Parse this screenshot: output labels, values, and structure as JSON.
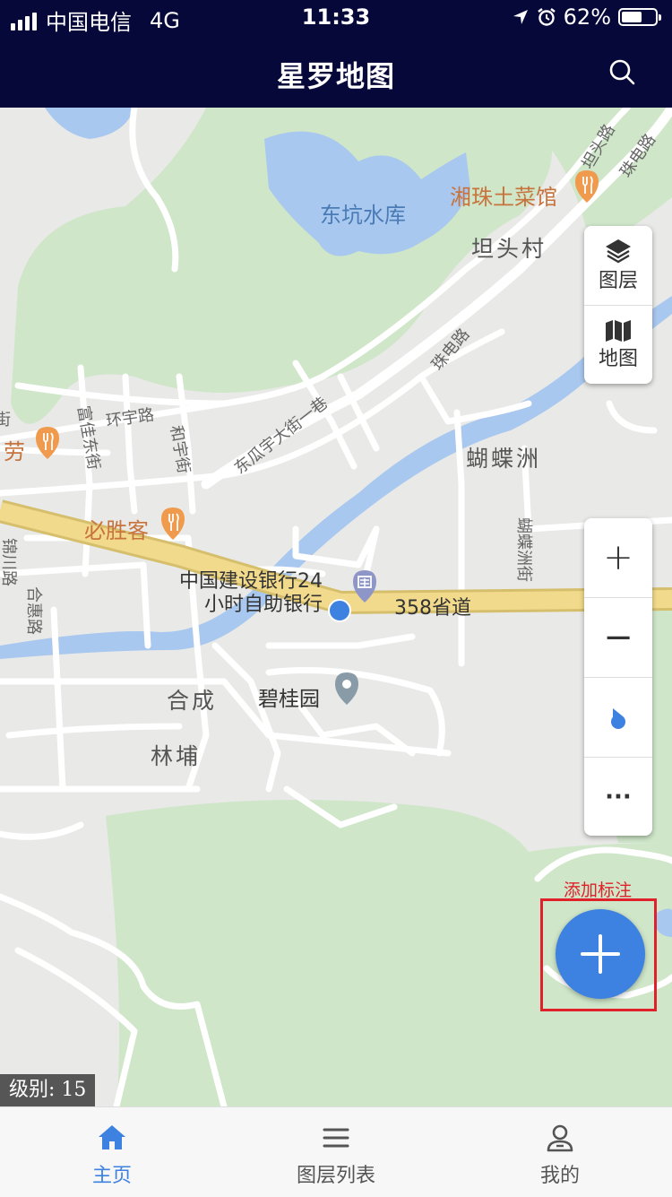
{
  "status_bar": {
    "carrier": "中国电信",
    "network": "4G",
    "time": "11:33",
    "battery_percent": "62%",
    "battery_level": 0.62
  },
  "nav": {
    "title": "星罗地图",
    "search_icon": "search-icon"
  },
  "map": {
    "labels": {
      "reservoir": "东坑水库",
      "restaurant_xiangzhu": "湘珠土菜馆",
      "village_tantou": "坦头村",
      "road_tantou": "坦头路",
      "road_zhudian_top": "珠电路",
      "road_zhudian_mid": "珠电路",
      "butterfly_island": "蝴蝶洲",
      "road_butterfly": "蝴蝶洲街",
      "road_huanyu": "环宇路",
      "road_fujia": "富佳东街",
      "road_heyu": "和宇街",
      "road_dongguayu": "东瓜宇大街一巷",
      "restaurant_lao": "劳",
      "restaurant_bishengke": "必胜客",
      "bank": "中国建设银行24小时自助银行",
      "bank_line1": "中国建设银行24",
      "bank_line2": "小时自助银行",
      "provincial_road": "358省道",
      "hecheng": "合成",
      "biguiyuan": "碧桂园",
      "linbu": "林埔",
      "road_hehui": "合惠路",
      "road_jinchuan": "锦川路",
      "road_jie_left": "街"
    },
    "colors": {
      "water": "#a9c8ef",
      "green": "#cfe6c9",
      "land": "#e9e9e7",
      "highway": "#f2da8c",
      "user_location": "#3d82e0"
    }
  },
  "layer_controls": {
    "layers_label": "图层",
    "map_label": "地图"
  },
  "zoom_controls": {
    "zoom_in": "+",
    "zoom_out": "−",
    "more": "···"
  },
  "fab": {
    "label": "添加标注"
  },
  "zoom_level": {
    "text": "级别: 15"
  },
  "tabs": [
    {
      "label": "主页",
      "icon": "home-icon",
      "active": true
    },
    {
      "label": "图层列表",
      "icon": "list-icon",
      "active": false
    },
    {
      "label": "我的",
      "icon": "user-icon",
      "active": false
    }
  ]
}
